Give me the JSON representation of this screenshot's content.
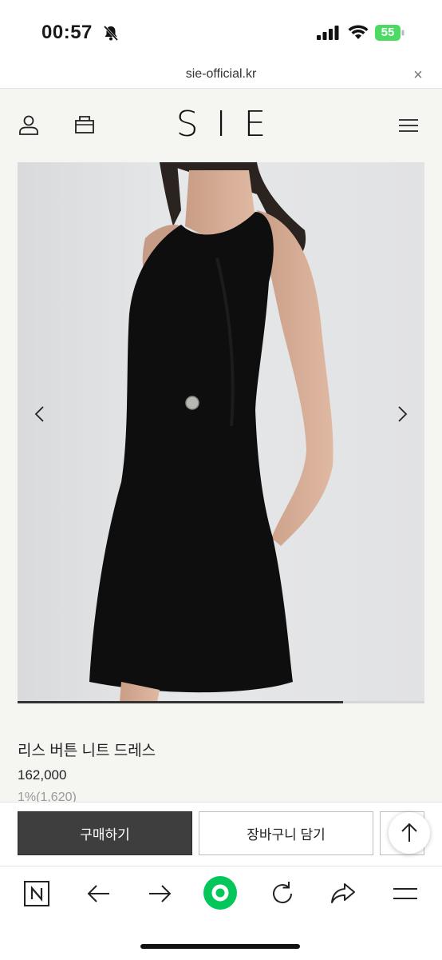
{
  "status_bar": {
    "time": "00:57",
    "battery_percent": "55",
    "battery_color": "#4cd964",
    "icons": [
      "bell-slash-icon",
      "signal-icon",
      "wifi-icon",
      "battery-icon"
    ]
  },
  "browser": {
    "url": "sie-official.kr",
    "close_symbol": "×"
  },
  "header": {
    "logo": "SIE",
    "icons": [
      "user-icon",
      "shopping-bag-icon",
      "hamburger-menu-icon"
    ]
  },
  "gallery": {
    "image_description_icon": "product-photo",
    "slide_progress": 0.8,
    "nav": [
      "chevron-left-icon",
      "chevron-right-icon"
    ]
  },
  "product": {
    "name": "리스 버튼 니트 드레스",
    "price": "162,000",
    "points": "1%(1,620)"
  },
  "actions": {
    "buy_label": "구매하기",
    "cart_label": "장바구니 담기",
    "top_icon": "arrow-up-icon"
  },
  "toolbar": {
    "items": [
      "naver-n-icon",
      "back-arrow-icon",
      "forward-arrow-icon",
      "green-home-icon",
      "refresh-icon",
      "share-icon",
      "menu-icon"
    ],
    "accent": "#03c75a"
  }
}
